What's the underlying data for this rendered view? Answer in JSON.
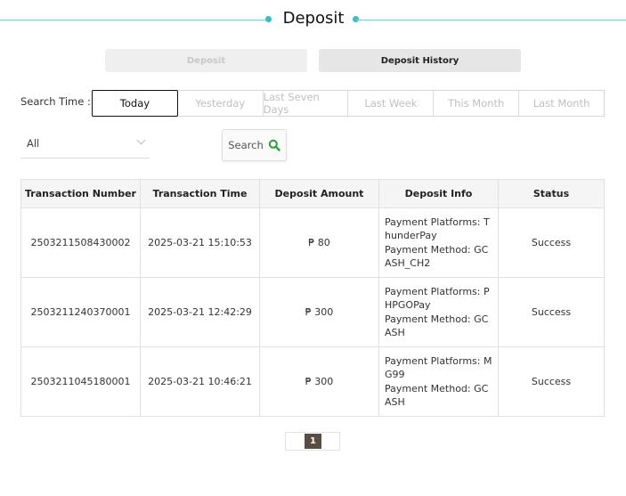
{
  "page": {
    "title": "Deposit"
  },
  "tabs": [
    {
      "label": "Deposit",
      "active": false
    },
    {
      "label": "Deposit History",
      "active": true
    }
  ],
  "search_time": {
    "label": "Search Time :",
    "options": [
      "Today",
      "Yesterday",
      "Last Seven Days",
      "Last Week",
      "This Month",
      "Last Month"
    ],
    "selected": "Today"
  },
  "filter": {
    "selected": "All"
  },
  "search_button": {
    "label": "Search",
    "icon": "search-icon"
  },
  "table": {
    "headers": [
      "Transaction Number",
      "Transaction Time",
      "Deposit Amount",
      "Deposit Info",
      "Status"
    ],
    "rows": [
      {
        "number": "2503211508430002",
        "time": "2025-03-21 15:10:53",
        "amount": "₱ 80",
        "info_platform": "Payment Platforms: ThunderPay",
        "info_method": "Payment Method: GCASH_CH2",
        "status": "Success"
      },
      {
        "number": "2503211240370001",
        "time": "2025-03-21 12:42:29",
        "amount": "₱ 300",
        "info_platform": "Payment Platforms: PHPGOPay",
        "info_method": "Payment Method: GCASH",
        "status": "Success"
      },
      {
        "number": "2503211045180001",
        "time": "2025-03-21 10:46:21",
        "amount": "₱ 300",
        "info_platform": "Payment Platforms: MG99",
        "info_method": "Payment Method: GCASH",
        "status": "Success"
      }
    ]
  },
  "pagination": {
    "current": "1"
  },
  "colors": {
    "accent": "#3bbcc0",
    "page_active": "#5a4d44",
    "search_icon": "#2e9e3a"
  }
}
